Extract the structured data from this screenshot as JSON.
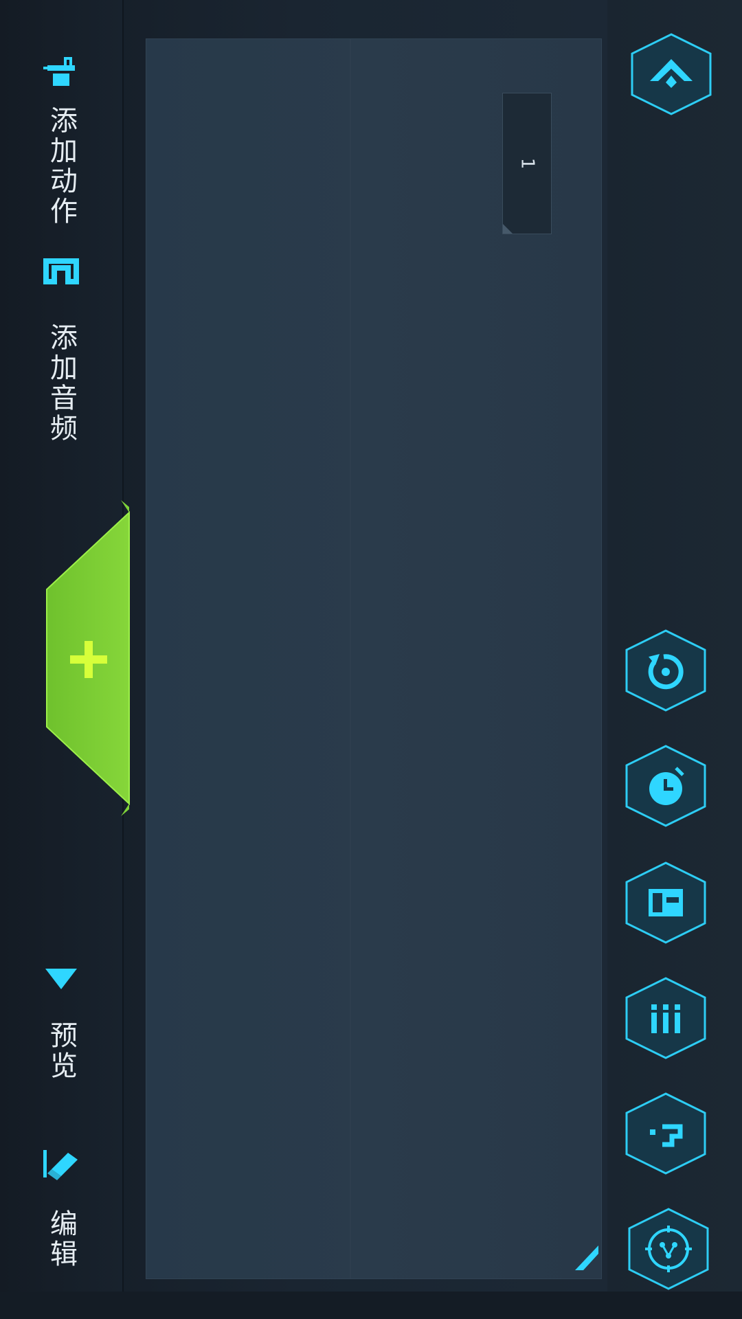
{
  "toolbar": {
    "add_action": "添加动作",
    "add_audio": "添加音频",
    "preview": "预览",
    "edit": "编辑"
  },
  "canvas": {
    "page_tab": "1"
  },
  "icons": {
    "add_action": "robot-action-icon",
    "add_audio": "music-note-icon",
    "add": "plus-icon",
    "preview": "play-triangle-icon",
    "edit": "pencil-icon",
    "collapse": "chevron-up-icon",
    "reset": "rotate-reset-icon",
    "timer": "stopwatch-icon",
    "save": "floppy-disk-icon",
    "list": "list-icon",
    "help": "question-icon",
    "connect": "connection-icon"
  },
  "colors": {
    "accent_cyan": "#2fd6ff",
    "accent_green": "#7ed23a",
    "plus_yellow": "#d7ff3a",
    "text": "#e6edf2"
  }
}
